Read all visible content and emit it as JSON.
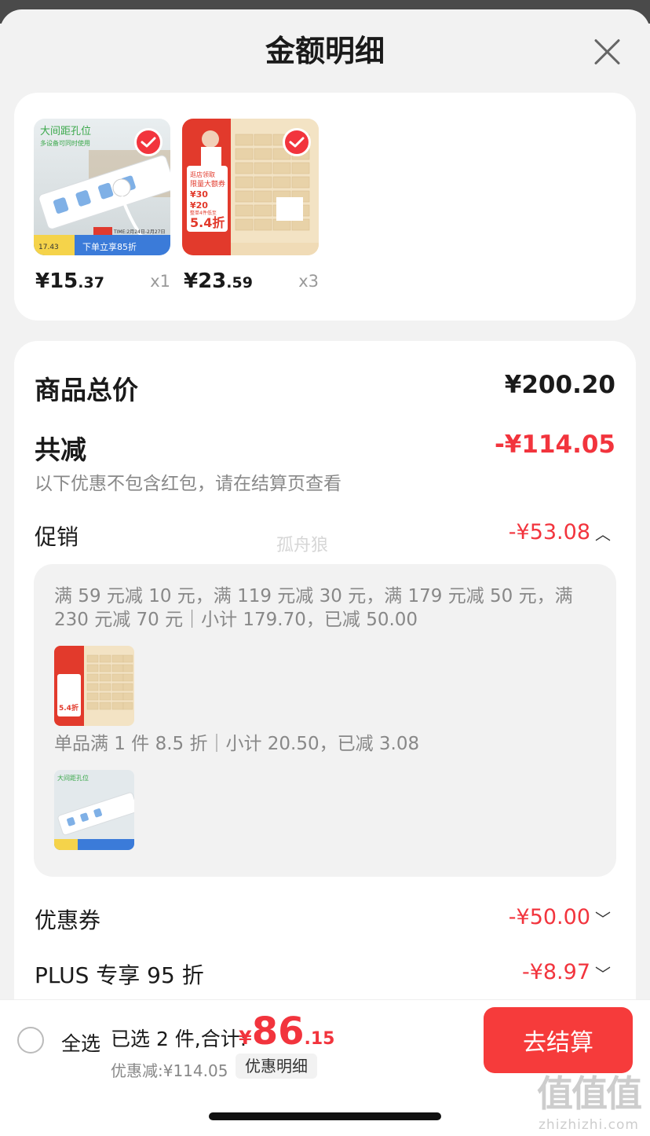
{
  "header": {
    "title": "金额明细"
  },
  "products": [
    {
      "price_main": "¥15",
      "price_cents": ".37",
      "qty": "x1",
      "thumb": {
        "headline": "大间距孔位",
        "sub": "多设备可同时使用",
        "badge_text": "下单立享85折",
        "price_tag": "17.43",
        "time_text": "TIME:2月24日-2月27日"
      }
    },
    {
      "price_main": "¥23",
      "price_cents": ".59",
      "qty": "x3",
      "thumb": {
        "l1": "逛店领取",
        "l2": "限量大额券",
        "v1": "¥30",
        "v2": "¥20",
        "l3": "整单4件低至",
        "disc": "5.4折"
      }
    }
  ],
  "summary": {
    "total_label": "商品总价",
    "total_value": "¥200.20",
    "reduce_label": "共减",
    "reduce_value": "-¥114.05",
    "reduce_note": "以下优惠不包含红包，请在结算页查看",
    "promo_label": "促销",
    "promo_value": "-¥53.08",
    "promo_text_1": "满 59 元减 10 元，满 119 元减 30 元，满 179 元减 50 元，满 230 元减 70 元｜小计 179.70，已减 50.00",
    "promo_text_2": "单品满 1 件 8.5 折｜小计 20.50，已减 3.08",
    "coupon_label": "优惠券",
    "coupon_value": "-¥50.00",
    "plus_label": "PLUS 专享 95 折",
    "plus_value": "-¥8.97"
  },
  "watermark": "孤舟狼",
  "bottom_bar": {
    "select_all": "全选",
    "selected_text": "已选 2 件,合计:",
    "total_symbol": "¥",
    "total_int": "86",
    "total_dec": ".15",
    "discount_text": "优惠减:¥114.05",
    "detail_tag": "优惠明细",
    "checkout": "去结算"
  },
  "site_mark": {
    "logo": "值值值",
    "domain": "zhizhizhi.com"
  },
  "colors": {
    "accent": "#f2343d",
    "button": "#f63b3b"
  }
}
